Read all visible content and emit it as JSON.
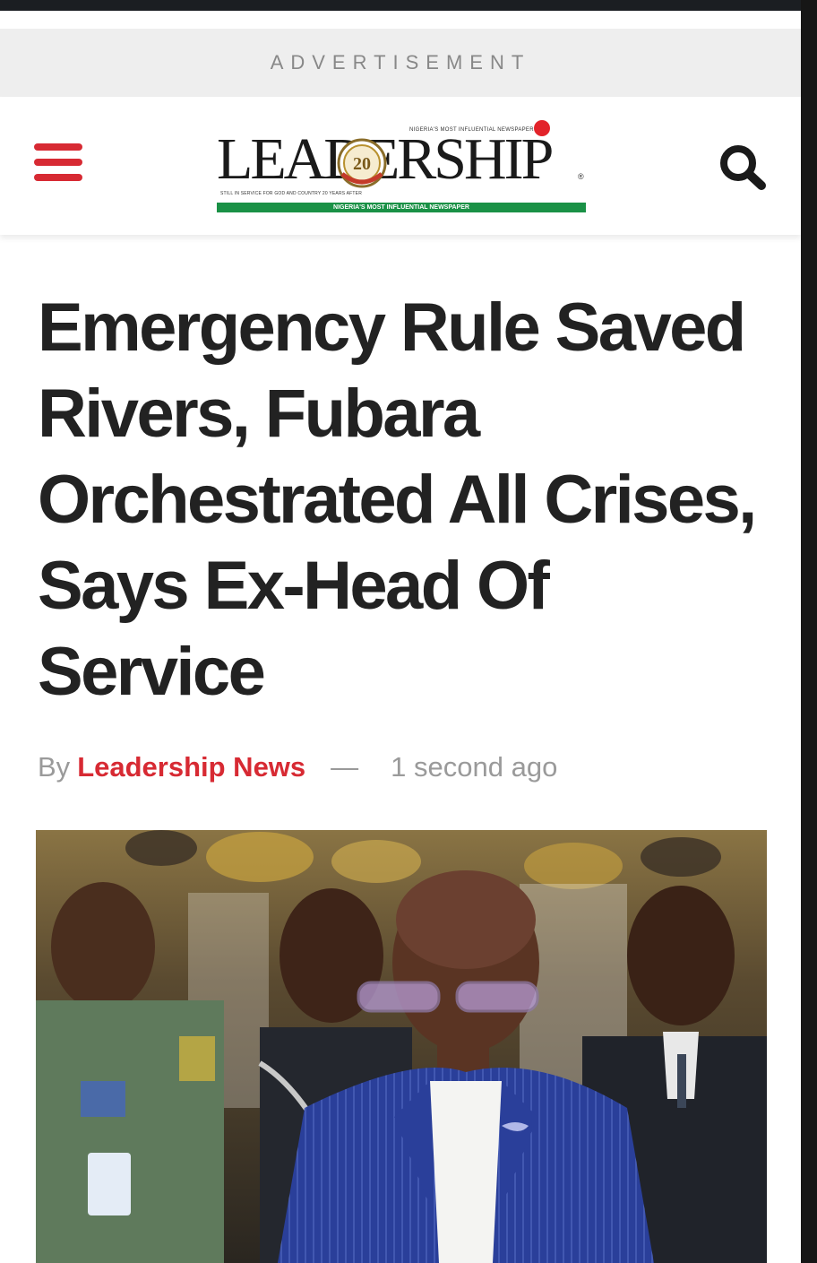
{
  "ad": {
    "label": "ADVERTISEMENT"
  },
  "header": {
    "logo": {
      "wordmark": "LEADERSHIP",
      "top_tag": "NIGERIA'S MOST INFLUENTIAL NEWSPAPER",
      "sub_tag": "STILL IN SERVICE FOR GOD AND COUNTRY 20 YEARS AFTER",
      "band": "NIGERIA'S MOST INFLUENTIAL NEWSPAPER",
      "badge": "20",
      "reg": "®"
    },
    "menu_icon": "hamburger-menu-icon",
    "search_icon": "search-icon"
  },
  "article": {
    "headline": "Emergency Rule Saved Rivers, Fubara Orchestrated All Crises, Says Ex-Head Of Service",
    "byline_prefix": "By",
    "author": "Leadership News",
    "separator": "—",
    "time": "1 second ago"
  },
  "colors": {
    "accent": "#d72a33",
    "brand_green": "#1a9146",
    "text": "#222222"
  }
}
